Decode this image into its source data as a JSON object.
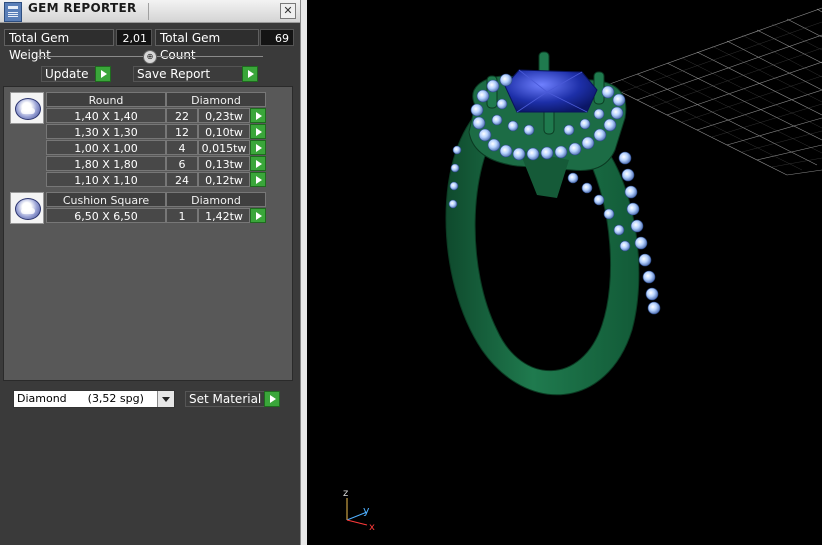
{
  "window": {
    "title": "GEM REPORTER",
    "close_glyph": "✕"
  },
  "stats": {
    "weight_label": "Total Gem Weight",
    "weight_value": "2,01",
    "count_label": "Total Gem Count",
    "count_value": "69"
  },
  "slider": {
    "knob_glyph": "⊕"
  },
  "buttons": {
    "update_label": "Update",
    "save_report_label": "Save Report",
    "set_material_label": "Set Material"
  },
  "groups": [
    {
      "shape": "Round",
      "material": "Diamond",
      "rows": [
        {
          "size": "1,40 X 1,40",
          "count": "22",
          "weight": "0,23tw"
        },
        {
          "size": "1,30 X 1,30",
          "count": "12",
          "weight": "0,10tw"
        },
        {
          "size": "1,00 X 1,00",
          "count": "4",
          "weight": "0,015tw"
        },
        {
          "size": "1,80 X 1,80",
          "count": "6",
          "weight": "0,13tw"
        },
        {
          "size": "1,10 X 1,10",
          "count": "24",
          "weight": "0,12tw"
        }
      ]
    },
    {
      "shape": "Cushion Square",
      "material": "Diamond",
      "rows": [
        {
          "size": "6,50 X 6,50",
          "count": "1",
          "weight": "1,42tw"
        }
      ]
    }
  ],
  "material_select": {
    "value": "Diamond      (3,52 spg)"
  },
  "axes": {
    "z": "z",
    "y": "y",
    "x": "x"
  },
  "colors": {
    "ring": "#1f7a4e",
    "center_stone": "#1d2fa8",
    "accent_stone": "#b8d4ff",
    "grid": "#9a9a9a",
    "green_button": "#3aa63a"
  }
}
